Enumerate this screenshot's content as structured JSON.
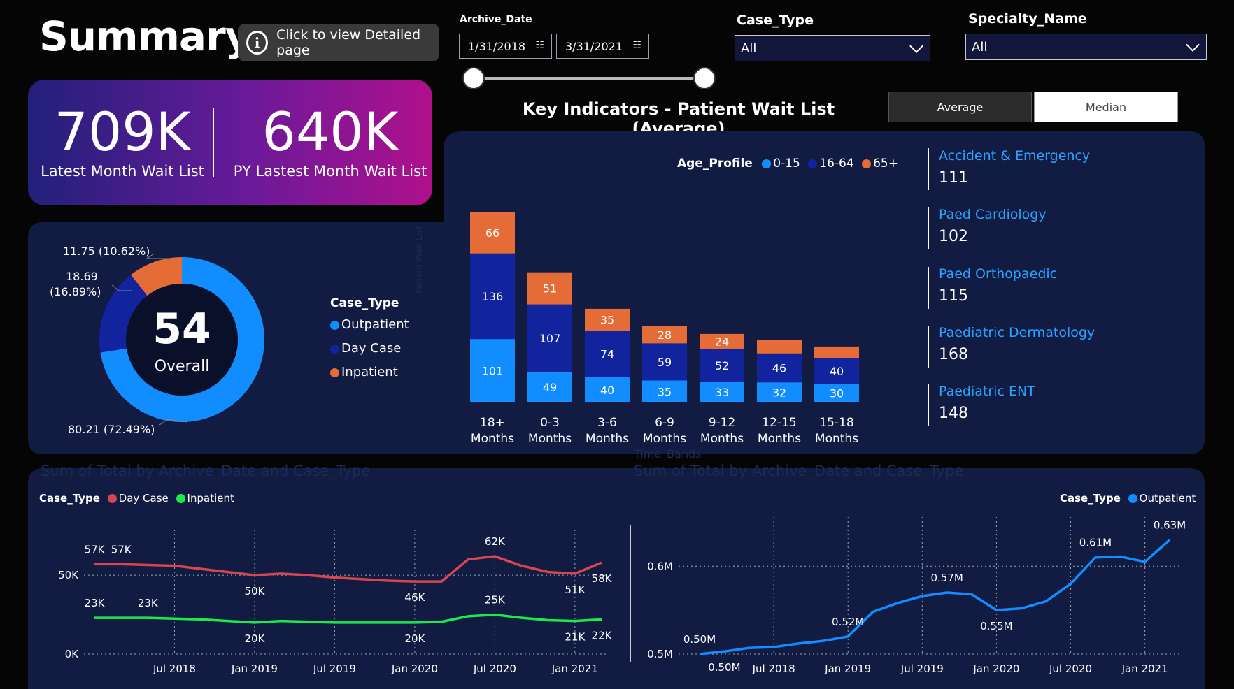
{
  "header": {
    "title": "Summary",
    "detail_button_label": "Click to view Detailed page"
  },
  "archive_date": {
    "label": "Archive_Date",
    "start": "1/31/2018",
    "end": "3/31/2021",
    "slider_range": [
      0,
      1
    ]
  },
  "case_type_filter": {
    "label": "Case_Type",
    "value": "All"
  },
  "specialty_filter": {
    "label": "Specialty_Name",
    "value": "All"
  },
  "kpi": {
    "latest_value": "709K",
    "latest_label": "Latest Month Wait List",
    "py_value": "640K",
    "py_label": "PY Lastest Month Wait List"
  },
  "key_indicators": {
    "title": "Key Indicators - Patient Wait List (Average)",
    "toggle_average": "Average",
    "toggle_median": "Median",
    "toggle_selected": "Average"
  },
  "donut": {
    "center_value": "54",
    "center_label": "Overall",
    "legend_title": "Case_Type",
    "label_inpatient": "11.75 (10.62%)",
    "label_daycase_a": "18.69",
    "label_daycase_b": "(16.89%)",
    "label_outpatient": "80.21 (72.49%)"
  },
  "specialties": [
    {
      "name": "Accident & Emergency",
      "value": "111"
    },
    {
      "name": "Paed Cardiology",
      "value": "102"
    },
    {
      "name": "Paed Orthopaedic",
      "value": "115"
    },
    {
      "name": "Paediatric Dermatology",
      "value": "168"
    },
    {
      "name": "Paediatric ENT",
      "value": "148"
    }
  ],
  "ghost_labels": {
    "time_bands": "Time_Bands",
    "left_chart_title": "Sum of Total by Archive_Date and Case_Type",
    "right_chart_title": "Sum of Total by Archive_Date and Case_Type",
    "patient_wait_list_axis": "Patient Wait List"
  },
  "line_left": {
    "legend_title": "Case_Type",
    "legend_daycase": "Day Case",
    "legend_inpatient": "Inpatient"
  },
  "line_right": {
    "legend_title": "Case_Type",
    "legend_outpatient": "Outpatient"
  },
  "colors": {
    "outpatient": "#118dff",
    "daycase": "#12239e",
    "inpatient": "#e66c37",
    "age_0_15": "#118dff",
    "age_16_64": "#12239e",
    "age_65": "#e66c37",
    "line_daycase": "#d64550",
    "line_inpatient": "#1aeb4a",
    "line_outpatient": "#118dff"
  },
  "chart_data": [
    {
      "type": "pie",
      "title": "",
      "categories": [
        "Outpatient",
        "Day Case",
        "Inpatient"
      ],
      "values": [
        80.21,
        18.69,
        11.75
      ],
      "percents": [
        72.49,
        16.89,
        10.62
      ],
      "legend_title": "Case_Type",
      "legend": "right"
    },
    {
      "type": "bar",
      "stacked": true,
      "title": "",
      "legend_title": "Age_Profile",
      "legend": "top",
      "categories": [
        "18+ Months",
        "0-3 Months",
        "3-6 Months",
        "6-9 Months",
        "9-12 Months",
        "12-15 Months",
        "15-18 Months"
      ],
      "series": [
        {
          "name": "0-15",
          "values": [
            101,
            49,
            40,
            35,
            33,
            32,
            30
          ]
        },
        {
          "name": "16-64",
          "values": [
            136,
            107,
            74,
            59,
            52,
            46,
            40
          ]
        },
        {
          "name": "65+",
          "values": [
            66,
            51,
            35,
            28,
            24,
            22,
            19
          ]
        }
      ],
      "ylim": [
        0,
        330
      ]
    },
    {
      "type": "line",
      "title": "",
      "legend_title": "Case_Type",
      "legend": "top-left",
      "x": [
        "Jan 2018",
        "Mar 2018",
        "May 2018",
        "Jul 2018",
        "Sep 2018",
        "Nov 2018",
        "Jan 2019",
        "Mar 2019",
        "May 2019",
        "Jul 2019",
        "Sep 2019",
        "Nov 2019",
        "Jan 2020",
        "Mar 2020",
        "May 2020",
        "Jul 2020",
        "Sep 2020",
        "Nov 2020",
        "Jan 2021",
        "Mar 2021"
      ],
      "xticks": [
        "Jul 2018",
        "Jan 2019",
        "Jul 2019",
        "Jan 2020",
        "Jul 2020",
        "Jan 2021"
      ],
      "yticks": [
        "0K",
        "50K"
      ],
      "ylim": [
        0,
        70
      ],
      "series": [
        {
          "name": "Day Case",
          "values": [
            57,
            57,
            56.5,
            56,
            54,
            52,
            50,
            51,
            50,
            48.5,
            47.5,
            46.5,
            46,
            46,
            60,
            62,
            56,
            52,
            51,
            58
          ],
          "labels": {
            "0": "57K",
            "1": "57K",
            "6": "50K",
            "12": "46K",
            "15": "62K",
            "18": "51K",
            "19": "58K"
          }
        },
        {
          "name": "Inpatient",
          "values": [
            23,
            23,
            23,
            22.5,
            22,
            21,
            20,
            21,
            20.5,
            20,
            20,
            20,
            20,
            20.5,
            24,
            25,
            23,
            21.5,
            21,
            22
          ],
          "labels": {
            "0": "23K",
            "2": "23K",
            "6": "20K",
            "12": "20K",
            "15": "25K",
            "18": "21K",
            "19": "22K"
          }
        }
      ]
    },
    {
      "type": "line",
      "title": "",
      "legend_title": "Case_Type",
      "legend": "top-right",
      "x": [
        "Jan 2018",
        "Mar 2018",
        "May 2018",
        "Jul 2018",
        "Sep 2018",
        "Nov 2018",
        "Jan 2019",
        "Mar 2019",
        "May 2019",
        "Jul 2019",
        "Sep 2019",
        "Nov 2019",
        "Jan 2020",
        "Mar 2020",
        "May 2020",
        "Jul 2020",
        "Sep 2020",
        "Nov 2020",
        "Jan 2021",
        "Mar 2021"
      ],
      "xticks": [
        "Jul 2018",
        "Jan 2019",
        "Jul 2019",
        "Jan 2020",
        "Jul 2020",
        "Jan 2021"
      ],
      "yticks": [
        "0.5M",
        "0.6M"
      ],
      "ylim": [
        0.5,
        0.64
      ],
      "series": [
        {
          "name": "Outpatient",
          "values": [
            0.5,
            0.503,
            0.507,
            0.508,
            0.512,
            0.515,
            0.52,
            0.548,
            0.558,
            0.566,
            0.57,
            0.568,
            0.55,
            0.552,
            0.56,
            0.58,
            0.61,
            0.611,
            0.605,
            0.63
          ],
          "labels": {
            "0": "0.50M",
            "1": "0.50M",
            "6": "0.52M",
            "10": "0.57M",
            "12": "0.55M",
            "16": "0.61M",
            "19": "0.63M"
          }
        }
      ]
    }
  ]
}
